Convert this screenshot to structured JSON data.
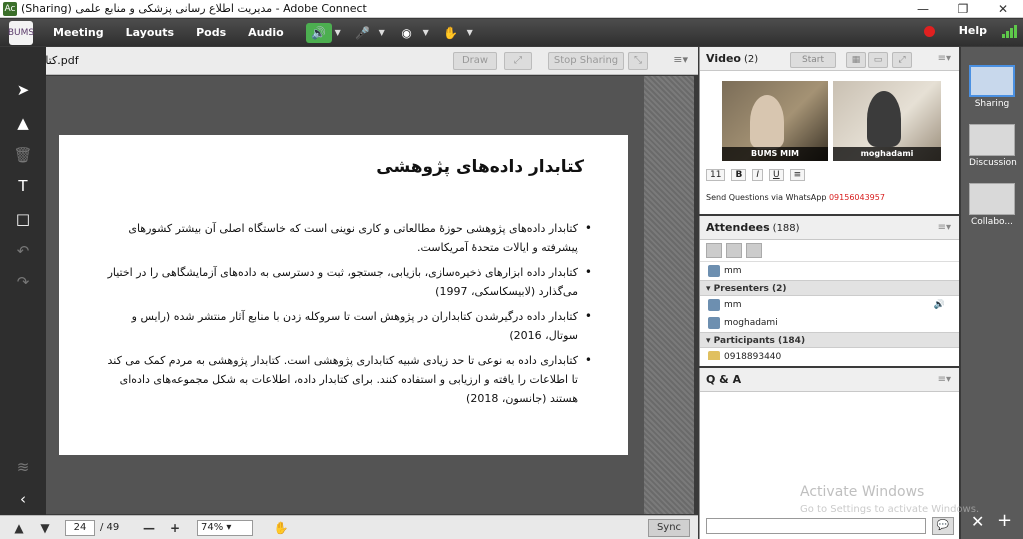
{
  "window": {
    "title": "(Sharing) مدیریت اطلاع رسانی پزشکی و منابع علمی - Adobe Connect",
    "app_icon": "Ac",
    "min": "—",
    "max": "❐",
    "close": "✕"
  },
  "menubar": {
    "logo": "BUMS",
    "items": [
      "Meeting",
      "Layouts",
      "Pods",
      "Audio"
    ],
    "help": "Help"
  },
  "share_pod": {
    "title": "کتابدار داده.pdf",
    "draw_label": "Draw",
    "stop_sharing_label": "Stop Sharing"
  },
  "slide": {
    "title": "کتابدار داده‌های پژوهشی",
    "bullets": [
      "کتابدار داده‌های پژوهشی حوزۀ مطالعاتی و کاری نوینی است که خاستگاه اصلی آن بیشتر کشورهای پیشرفته و ایالات متحدۀ آمریکاست.",
      "کتابدار داده ابزارهای ذخیره‌سازی، بازیابی، جستجو، ثبت و دسترسی به داده‌های آزمایشگاهی را در اختیار می‌گذارد (لابیسکاسکی، 1997)",
      "کتابدار داده درگیرشدن کتابداران در پژوهش است تا سروکله زدن با منابع آثار منتشر شده (رایس و سوتال، 2016)",
      "کتابداری داده به نوعی تا حد زیادی شبیه کتابداری پژوهشی است. کتابدار پژوهشی به مردم کمک می کند تا اطلاعات را یافته و ارزیابی و استفاده کنند. برای کتابدار داده، اطلاعات به شکل مجموعه‌های داده‌ای هستند (جانسون، 2018)"
    ]
  },
  "bottombar": {
    "current_page": "24",
    "total_pages": "/ 49",
    "zoom": "74%",
    "sync_label": "Sync"
  },
  "video_pod": {
    "title": "Video",
    "count": "(2)",
    "start_label": "Start",
    "participants": [
      "BUMS MIM",
      "moghadami"
    ],
    "note_prefix": "Send Questions via WhatsApp",
    "note_phone": "09156043957",
    "font_size": "11"
  },
  "attendees_pod": {
    "title": "Attendees",
    "count": "(188)",
    "self": "mm",
    "presenters_label": "Presenters (2)",
    "presenters": [
      "mm",
      "moghadami"
    ],
    "participants_label": "Participants (184)",
    "first_participant": "0918893440"
  },
  "qa_pod": {
    "title": "Q & A"
  },
  "layouts": [
    {
      "label": "Sharing"
    },
    {
      "label": "Discussion"
    },
    {
      "label": "Collabo..."
    }
  ],
  "watermark": {
    "line1": "Activate Windows",
    "line2": "Go to Settings to activate Windows."
  },
  "colors": {
    "record": "#e02020",
    "phone": "#d81e1e",
    "selected_layout": "#4a90e2",
    "mic_active": "#4caf50"
  }
}
